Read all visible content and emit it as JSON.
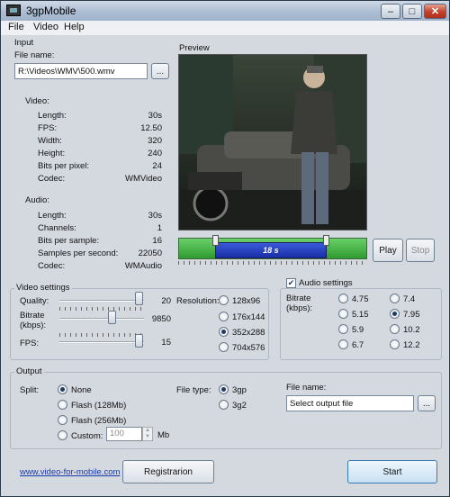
{
  "window": {
    "title": "3gpMobile"
  },
  "menu": [
    "File",
    "Video",
    "Help"
  ],
  "input": {
    "group_label": "Input",
    "file_name_label": "File name:",
    "file_name_value": "R:\\Videos\\WMV\\500.wmv",
    "browse_label": "...",
    "video_heading": "Video:",
    "video_props": [
      {
        "label": "Length:",
        "value": "30s"
      },
      {
        "label": "FPS:",
        "value": "12.50"
      },
      {
        "label": "Width:",
        "value": "320"
      },
      {
        "label": "Height:",
        "value": "240"
      },
      {
        "label": "Bits per pixel:",
        "value": "24"
      },
      {
        "label": "Codec:",
        "value": "WMVideo"
      }
    ],
    "audio_heading": "Audio:",
    "audio_props": [
      {
        "label": "Length:",
        "value": "30s"
      },
      {
        "label": "Channels:",
        "value": "1"
      },
      {
        "label": "Bits per sample:",
        "value": "16"
      },
      {
        "label": "Samples per second:",
        "value": "22050"
      },
      {
        "label": "Codec:",
        "value": "WMAudio"
      }
    ]
  },
  "preview": {
    "label": "Preview",
    "timeline_time": "18 s",
    "play_label": "Play",
    "stop_label": "Stop",
    "selection_start_fraction": 0.19,
    "selection_end_fraction": 0.79
  },
  "video_settings": {
    "group_label": "Video settings",
    "quality_label": "Quality:",
    "quality_value": "20",
    "bitrate_label": "Bitrate\n(kbps):",
    "bitrate_value": "9850",
    "fps_label": "FPS:",
    "fps_value": "15",
    "resolution_label": "Resolution:",
    "resolutions": [
      {
        "label": "128x96",
        "selected": false
      },
      {
        "label": "176x144",
        "selected": false
      },
      {
        "label": "352x288",
        "selected": true
      },
      {
        "label": "704x576",
        "selected": false
      }
    ]
  },
  "audio_settings": {
    "group_label": "Audio settings",
    "enabled": true,
    "bitrate_label": "Bitrate\n(kbps):",
    "bitrates": [
      {
        "label": "4.75",
        "selected": false
      },
      {
        "label": "7.4",
        "selected": false
      },
      {
        "label": "5.15",
        "selected": false
      },
      {
        "label": "7.95",
        "selected": true
      },
      {
        "label": "5.9",
        "selected": false
      },
      {
        "label": "10.2",
        "selected": false
      },
      {
        "label": "6.7",
        "selected": false
      },
      {
        "label": "12.2",
        "selected": false
      }
    ]
  },
  "output": {
    "group_label": "Output",
    "split_label": "Split:",
    "split_options": [
      {
        "label": "None",
        "selected": true
      },
      {
        "label": "Flash (128Mb)",
        "selected": false
      },
      {
        "label": "Flash (256Mb)",
        "selected": false
      },
      {
        "label": "Custom:",
        "selected": false
      }
    ],
    "custom_value": "100",
    "custom_unit": "Mb",
    "file_type_label": "File type:",
    "file_types": [
      {
        "label": "3gp",
        "selected": true
      },
      {
        "label": "3g2",
        "selected": false
      }
    ],
    "file_name_label": "File name:",
    "file_name_placeholder": "Select output file",
    "browse_label": "..."
  },
  "footer": {
    "link": "www.video-for-mobile.com",
    "registration_label": "Registrarion",
    "start_label": "Start"
  }
}
